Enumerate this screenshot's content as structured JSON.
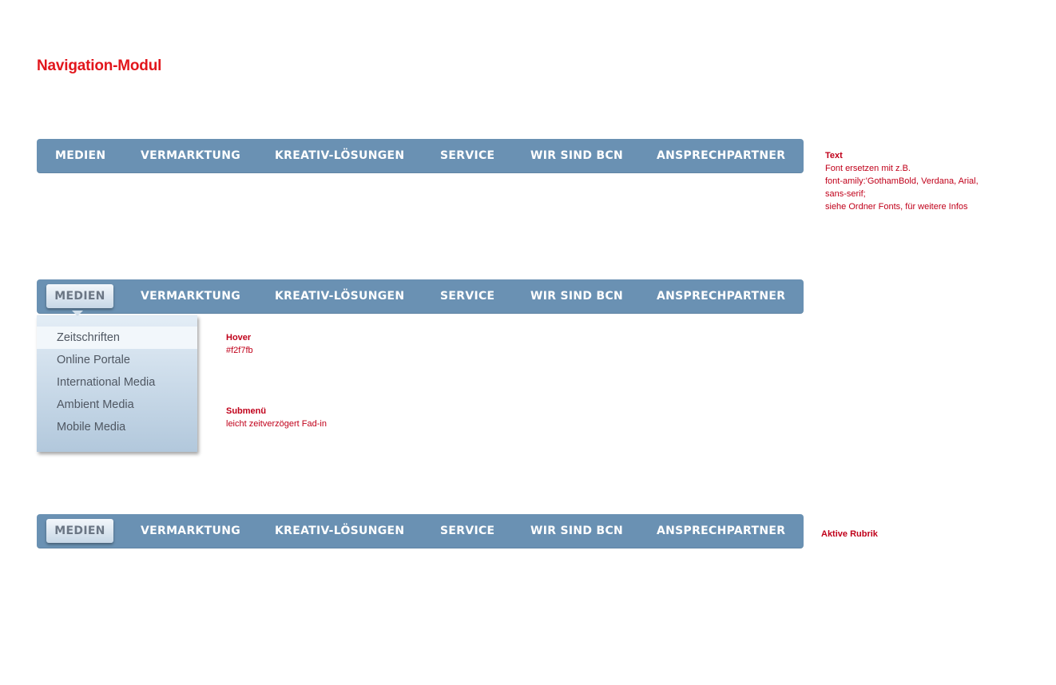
{
  "page_title": "Navigation-Modul",
  "nav_items": [
    "MEDIEN",
    "VERMARKTUNG",
    "KREATIV-LÖSUNGEN",
    "SERVICE",
    "WIR SIND BCN",
    "ANSPRECHPARTNER"
  ],
  "submenu_items": [
    "Zeitschriften",
    "Online Portale",
    "International Media",
    "Ambient Media",
    "Mobile Media"
  ],
  "notes": {
    "text": {
      "title": "Text",
      "lines": [
        "Font ersetzen mit z.B.",
        "font-amily:'GothamBold, Verdana, Arial,",
        "sans-serif;",
        "siehe Ordner Fonts, für weitere Infos"
      ]
    },
    "hover": {
      "title": "Hover",
      "line": "#f2f7fb"
    },
    "submenu": {
      "title": "Submenü",
      "line": "leicht zeitverzögert Fad-in"
    },
    "active": {
      "title": "Aktive Rubrik"
    }
  },
  "colors": {
    "nav_bg": "#6a91b3",
    "title": "#e2161c",
    "note": "#c0001a",
    "hover": "#f2f7fb"
  }
}
